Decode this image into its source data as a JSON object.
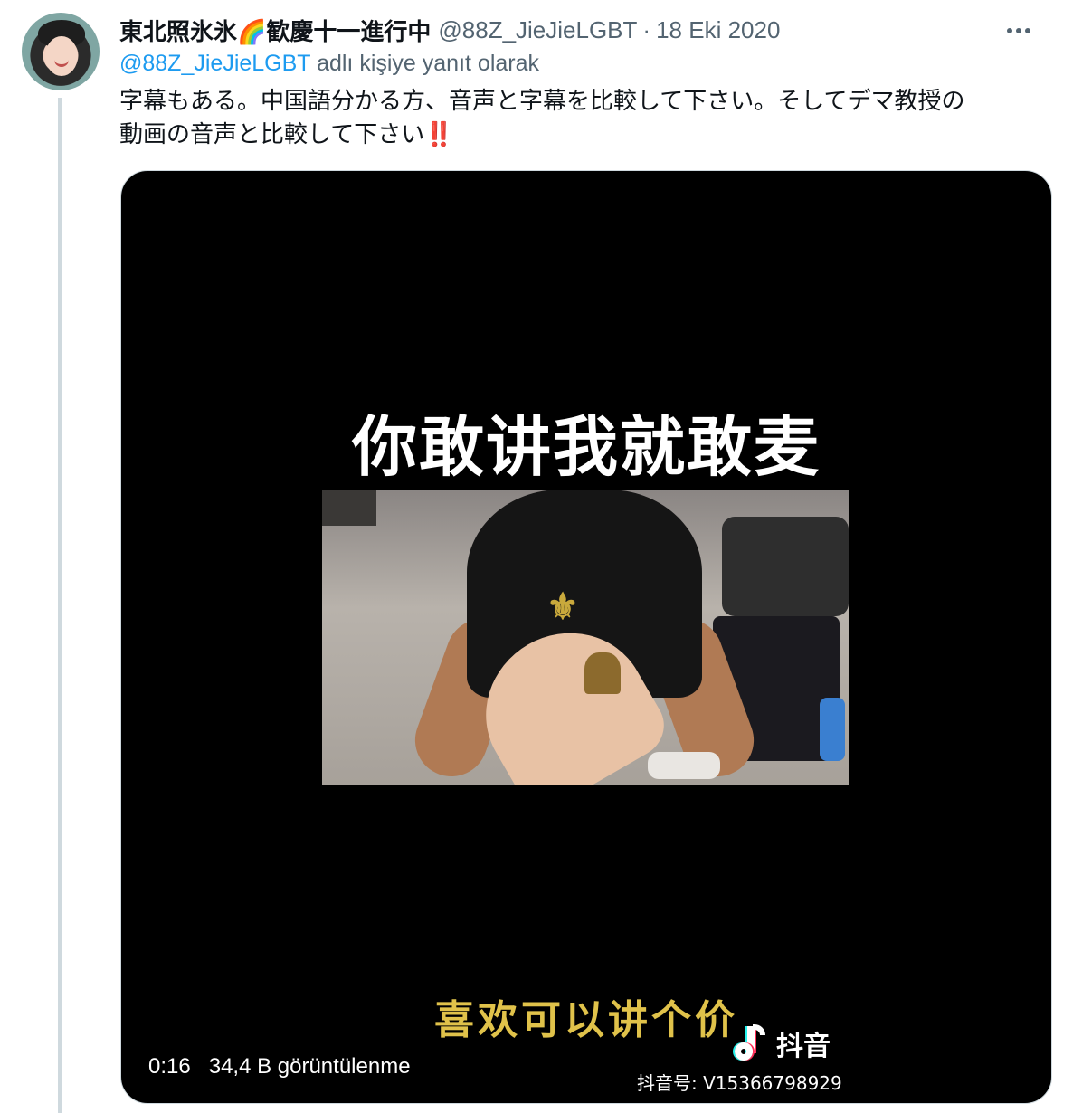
{
  "author": {
    "display_name": "東北照氷氷🌈歓慶十一進行中",
    "handle": "@88Z_JieJieLGBT",
    "separator": "·",
    "date": "18 Eki 2020"
  },
  "reply": {
    "handle": "@88Z_JieJieLGBT",
    "suffix": " adlı kişiye yanıt olarak"
  },
  "tweet": {
    "line1": "字幕もある。中国語分かる方、音声と字幕を比較して下さい。そしてデマ教授の",
    "line2": "動画の音声と比較して下さい",
    "emphasis": "‼️"
  },
  "video": {
    "caption_top": "你敢讲我就敢麦",
    "caption_bottom": "喜欢可以讲个价",
    "tiktok_label": "抖音",
    "tiktok_id": "抖音号: V15366798929",
    "time": "0:16",
    "views": "34,4 B görüntülenme"
  },
  "colors": {
    "link": "#1d9bf0",
    "secondary": "#536471",
    "caption_gold": "#e0c24a"
  }
}
